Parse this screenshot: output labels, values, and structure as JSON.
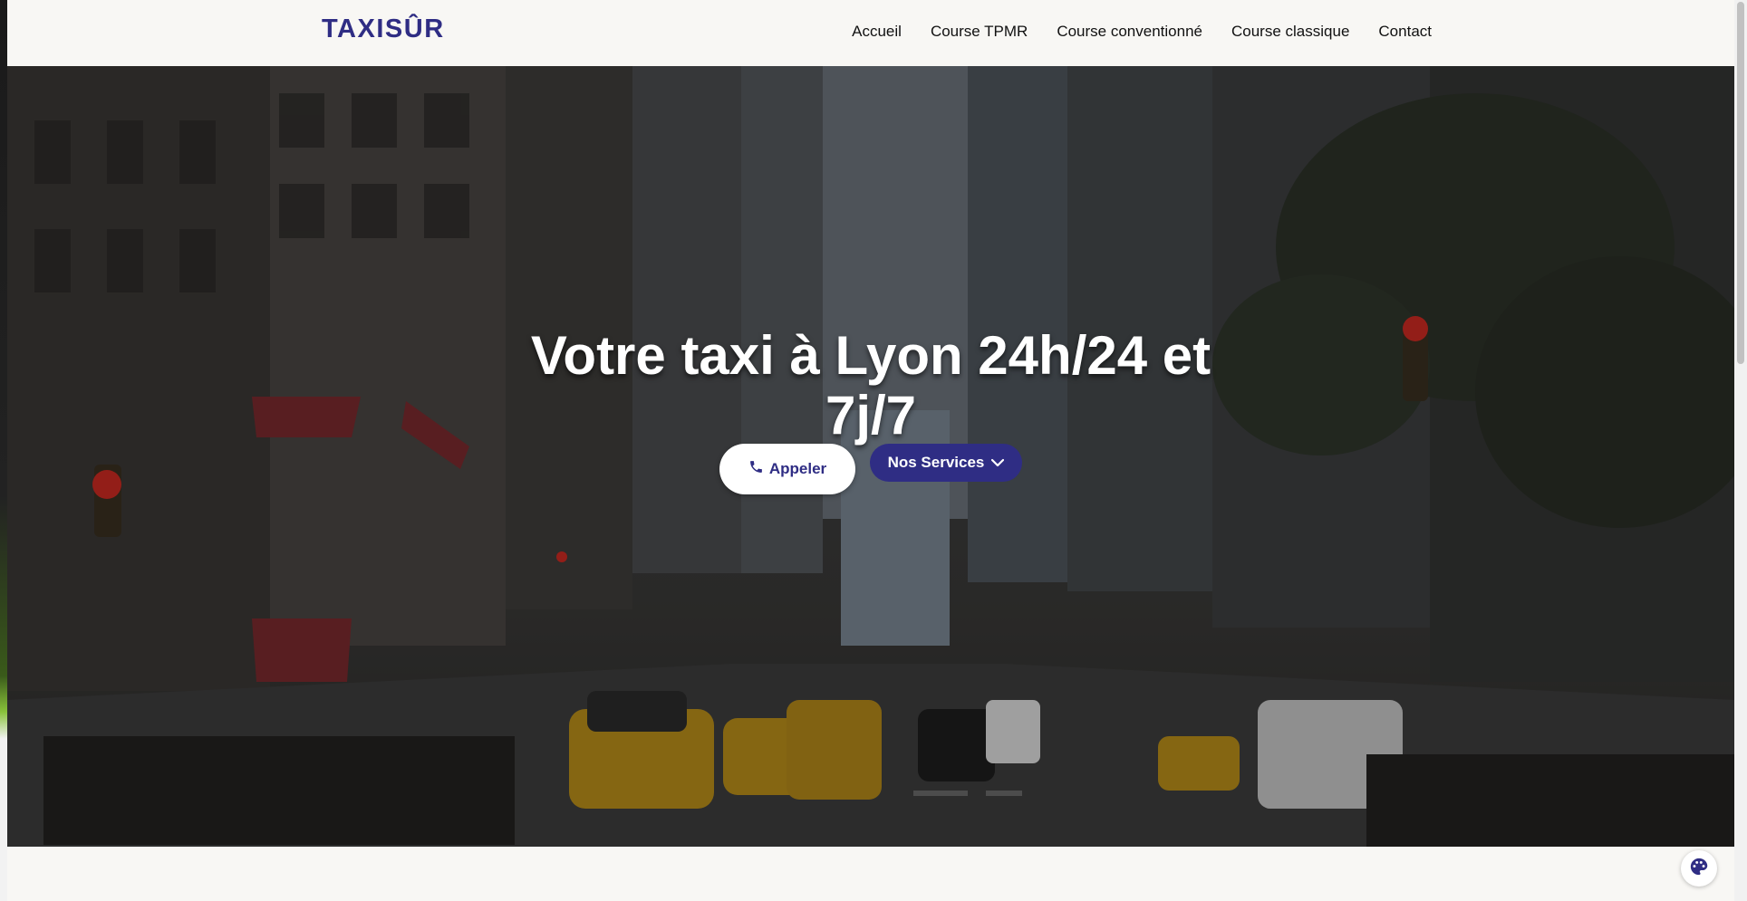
{
  "brand": {
    "logo_text": "TAXISÛR",
    "accent_color": "#2f2d84"
  },
  "nav": {
    "items": [
      {
        "label": "Accueil"
      },
      {
        "label": "Course TPMR"
      },
      {
        "label": "Course conventionné"
      },
      {
        "label": "Course classique"
      },
      {
        "label": "Contact"
      }
    ]
  },
  "hero": {
    "title_line1": "Votre taxi à Lyon 24h/24 et",
    "title_line2": "7j/7",
    "call_button": {
      "label": "Appeler",
      "icon": "phone-icon"
    },
    "services_button": {
      "label": "Nos Services",
      "icon": "chevron-down-icon"
    },
    "background": "city street with yellow taxis"
  },
  "widgets": {
    "palette_icon": "palette-icon"
  }
}
